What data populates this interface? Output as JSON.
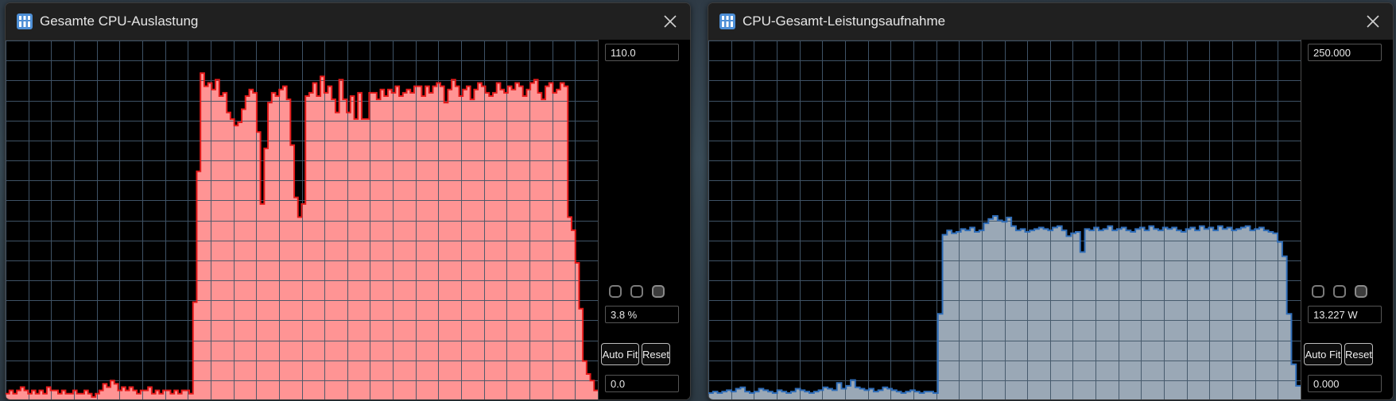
{
  "windows": [
    {
      "title": "Gesamte CPU-Auslastung",
      "max_value": "110.0",
      "current_value": "3.8 %",
      "min_value": "0.0",
      "auto_fit_label": "Auto Fit",
      "reset_label": "Reset",
      "fill_color": "#ff9494",
      "line_color": "#e51b1b",
      "chart_data": {
        "type": "area",
        "ylim": [
          0,
          110
        ],
        "values": [
          2,
          3,
          2,
          3,
          4,
          3,
          2,
          3,
          2,
          3,
          2,
          4,
          3,
          3,
          2,
          3,
          2,
          2,
          3,
          2,
          2,
          3,
          2,
          1,
          2,
          3,
          5,
          4,
          6,
          5,
          3,
          4,
          3,
          4,
          3,
          2,
          3,
          3,
          4,
          2,
          3,
          2,
          3,
          3,
          2,
          3,
          2,
          3,
          3,
          2,
          30,
          70,
          100,
          96,
          97,
          95,
          98,
          93,
          94,
          88,
          86,
          84,
          85,
          89,
          93,
          95,
          94,
          82,
          60,
          77,
          91,
          94,
          93,
          95,
          96,
          92,
          78,
          62,
          56,
          60,
          93,
          94,
          97,
          93,
          99,
          94,
          96,
          92,
          88,
          98,
          92,
          88,
          93,
          86,
          94,
          86,
          86,
          94,
          94,
          92,
          95,
          93,
          95,
          94,
          96,
          93,
          94,
          95,
          94,
          96,
          96,
          93,
          96,
          94,
          96,
          97,
          96,
          91,
          95,
          98,
          96,
          93,
          95,
          96,
          92,
          95,
          97,
          96,
          94,
          93,
          94,
          97,
          95,
          94,
          96,
          95,
          97,
          96,
          93,
          95,
          97,
          98,
          94,
          92,
          96,
          97,
          94,
          95,
          97,
          96,
          56,
          52,
          42,
          28,
          12,
          8,
          6,
          3
        ]
      }
    },
    {
      "title": "CPU-Gesamt-Leistungsaufnahme",
      "max_value": "250.000",
      "current_value": "13.227 W",
      "min_value": "0.000",
      "auto_fit_label": "Auto Fit",
      "reset_label": "Reset",
      "fill_color": "#9aa8b6",
      "line_color": "#2f6db8",
      "chart_data": {
        "type": "area",
        "ylim": [
          0,
          250
        ],
        "values": [
          5,
          6,
          5,
          6,
          7,
          6,
          8,
          9,
          6,
          5,
          6,
          8,
          7,
          6,
          5,
          7,
          6,
          5,
          6,
          8,
          7,
          6,
          5,
          6,
          7,
          9,
          8,
          7,
          12,
          8,
          10,
          14,
          9,
          8,
          7,
          8,
          6,
          7,
          9,
          8,
          7,
          6,
          5,
          6,
          7,
          6,
          5,
          6,
          6,
          5,
          60,
          115,
          118,
          116,
          117,
          119,
          118,
          120,
          117,
          118,
          123,
          126,
          128,
          125,
          124,
          127,
          121,
          118,
          119,
          117,
          118,
          119,
          120,
          119,
          118,
          120,
          121,
          118,
          114,
          116,
          117,
          103,
          119,
          118,
          120,
          118,
          119,
          121,
          118,
          119,
          120,
          118,
          117,
          119,
          120,
          118,
          121,
          119,
          118,
          120,
          119,
          120,
          118,
          117,
          119,
          120,
          118,
          121,
          119,
          120,
          118,
          121,
          119,
          120,
          118,
          119,
          120,
          121,
          118,
          119,
          120,
          118,
          117,
          116,
          110,
          100,
          60,
          25,
          10
        ]
      }
    }
  ],
  "icons": {
    "app": "hwinfo-app-icon",
    "close": "close-icon",
    "toggles": [
      "toggle-icon",
      "toggle-icon",
      "toggle-icon"
    ]
  },
  "colors": {
    "grid": "#3f5366",
    "plot_background": "#000000"
  }
}
